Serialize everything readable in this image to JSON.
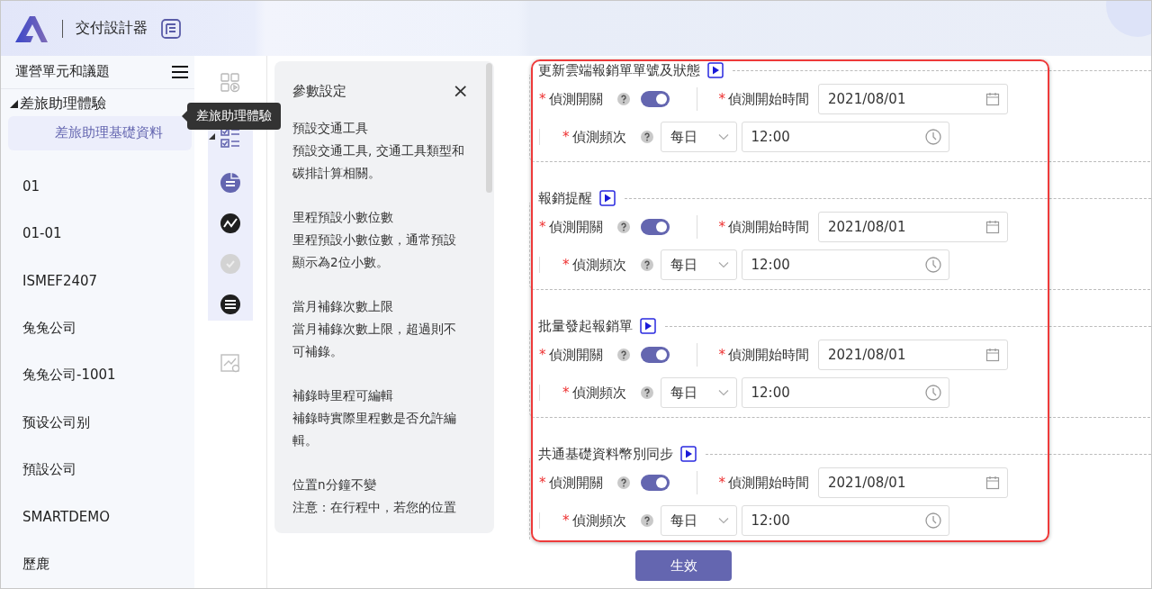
{
  "header": {
    "title": "交付設計器"
  },
  "sidebar": {
    "title": "運營單元和議題",
    "groups": [
      {
        "label": "差旅助理體驗",
        "expanded": true,
        "children": [
          {
            "label": "差旅助理基礎資料",
            "selected": true
          }
        ]
      }
    ],
    "items": [
      {
        "label": "01",
        "selected": false
      },
      {
        "label": "01-01",
        "selected": false
      },
      {
        "label": "ISMEF2407",
        "selected": false
      },
      {
        "label": "兔兔公司",
        "selected": false
      },
      {
        "label": "兔兔公司-1001",
        "selected": false
      },
      {
        "label": "预设公司别",
        "selected": false
      },
      {
        "label": "預設公司",
        "selected": false
      },
      {
        "label": "SMARTDEMO",
        "selected": false
      },
      {
        "label": "歷鹿",
        "selected": false
      }
    ]
  },
  "tooltip": {
    "text": "差旅助理體驗"
  },
  "help_panel": {
    "title": "參數設定",
    "close": "×",
    "entries": [
      {
        "title": "預設交通工具",
        "description": "預設交通工具, 交通工具類型和碳排計算相關。"
      },
      {
        "title": "里程預設小數位數",
        "description": "里程預設小數位數，通常預設顯示為2位小數。"
      },
      {
        "title": "當月補錄次數上限",
        "description": "當月補錄次數上限，超過則不可補錄。"
      },
      {
        "title": "補錄時里程可編輯",
        "description": "補錄時實際里程數是否允許編輯。"
      },
      {
        "title": "位置n分鐘不變",
        "description": "注意：在行程中，若您的位置"
      }
    ]
  },
  "tasks": [
    {
      "title": "更新雲端報銷單單號及狀態",
      "toggle_label": {
        "mark": "*",
        "text": "偵測開關"
      },
      "on": true,
      "start_label": {
        "mark": "*",
        "text": "偵測開始時間"
      },
      "start_date": "2021/08/01",
      "frequency_label": {
        "mark": "*",
        "text": "偵測頻次"
      },
      "frequency": "每日",
      "time": "12:00"
    },
    {
      "title": "報銷提醒",
      "toggle_label": {
        "mark": "*",
        "text": "偵測開關"
      },
      "on": true,
      "start_label": {
        "mark": "*",
        "text": "偵測開始時間"
      },
      "start_date": "2021/08/01",
      "frequency_label": {
        "mark": "*",
        "text": "偵測頻次"
      },
      "frequency": "每日",
      "time": "12:00"
    },
    {
      "title": "批量發起報銷單",
      "toggle_label": {
        "mark": "*",
        "text": "偵測開關"
      },
      "on": true,
      "start_label": {
        "mark": "*",
        "text": "偵測開始時間"
      },
      "start_date": "2021/08/01",
      "frequency_label": {
        "mark": "*",
        "text": "偵測頻次"
      },
      "frequency": "每日",
      "time": "12:00"
    },
    {
      "title": "共通基礎資料幣別同步",
      "toggle_label": {
        "mark": "*",
        "text": "偵測開關"
      },
      "on": true,
      "start_label": {
        "mark": "*",
        "text": "偵測開始時間"
      },
      "start_date": "2021/08/01",
      "frequency_label": {
        "mark": "*",
        "text": "偵測頻次"
      },
      "frequency": "每日",
      "time": "12:00"
    }
  ],
  "submit_button": "生效"
}
